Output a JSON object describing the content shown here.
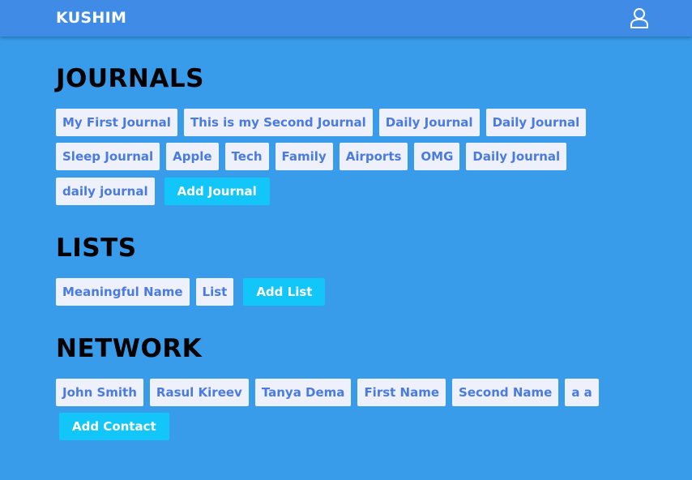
{
  "header": {
    "brand": "KUSHIM",
    "user_icon": "user-icon"
  },
  "journals": {
    "title": "JOURNALS",
    "items": [
      "My First Journal",
      "This is my Second Journal",
      "Daily Journal",
      "Daily Journal",
      "Sleep Journal",
      "Apple",
      "Tech",
      "Family",
      "Airports",
      "OMG",
      "Daily Journal",
      "daily journal"
    ],
    "add_label": "Add Journal"
  },
  "lists": {
    "title": "LISTS",
    "items": [
      "Meaningful Name",
      "List"
    ],
    "add_label": "Add List"
  },
  "network": {
    "title": "NETWORK",
    "items": [
      "John Smith",
      "Rasul Kireev",
      "Tanya Dema",
      "First Name",
      "Second Name",
      "a a"
    ],
    "add_label": "Add Contact"
  },
  "colors": {
    "background": "#389ceb",
    "topbar": "#3f8be6",
    "chip_bg": "#eef1fb",
    "chip_text": "#4a7be0",
    "add_button": "#13c6f9"
  }
}
